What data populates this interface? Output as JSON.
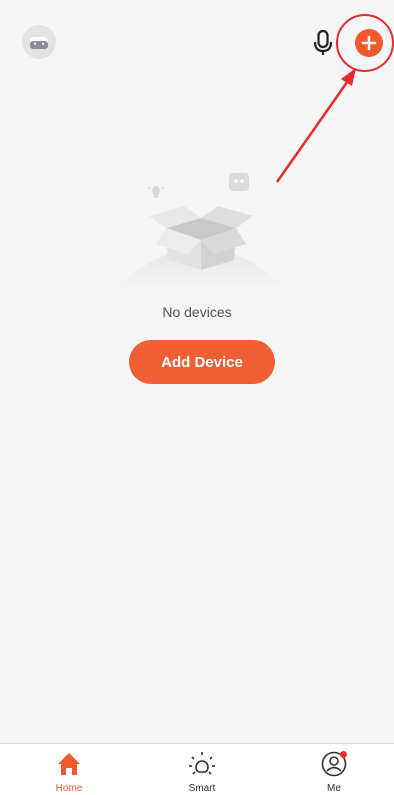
{
  "header": {
    "avatar_icon": "robot-face-icon",
    "mic_icon": "microphone-icon",
    "add_icon": "plus-icon"
  },
  "empty_state": {
    "message": "No devices",
    "button_label": "Add Device"
  },
  "tabs": [
    {
      "label": "Home",
      "icon": "house-icon",
      "active": true
    },
    {
      "label": "Smart",
      "icon": "sun-icon",
      "active": false
    },
    {
      "label": "Me",
      "icon": "person-icon",
      "active": false,
      "badge": true
    }
  ],
  "colors": {
    "accent": "#f0582e",
    "highlight": "#e82a2a",
    "background": "#f6f6f6"
  }
}
